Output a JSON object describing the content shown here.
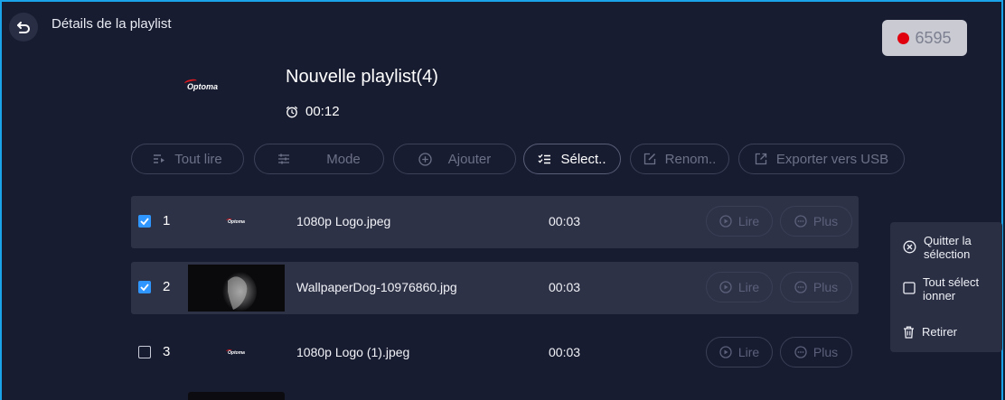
{
  "header": {
    "title": "Détails de la playlist",
    "badge_value": "6595",
    "badge_dot_color": "#e1000e"
  },
  "playlist": {
    "logo_text": "Optoma",
    "title": "Nouvelle playlist(4)",
    "duration": "00:12"
  },
  "toolbar": {
    "play_all": "Tout lire",
    "mode": "Mode",
    "add": "Ajouter",
    "select": "Sélect..",
    "rename": "Renom..",
    "export": "Exporter vers USB"
  },
  "rows": [
    {
      "index": "1",
      "name": "1080p Logo.jpeg",
      "duration": "00:03",
      "play": "Lire",
      "more": "Plus",
      "checked": true
    },
    {
      "index": "2",
      "name": "WallpaperDog-10976860.jpg",
      "duration": "00:03",
      "play": "Lire",
      "more": "Plus",
      "checked": true
    },
    {
      "index": "3",
      "name": "1080p Logo (1).jpeg",
      "duration": "00:03",
      "play": "Lire",
      "more": "Plus",
      "checked": false
    }
  ],
  "context_menu": {
    "quit_line1": "Quitter la",
    "quit_line2": "sélection",
    "selectall_line1": "Tout sélect",
    "selectall_line2": "ionner",
    "remove": "Retirer"
  },
  "colors": {
    "accent": "#2f95ff",
    "frame": "#1aa3e8",
    "background": "#181c31"
  }
}
